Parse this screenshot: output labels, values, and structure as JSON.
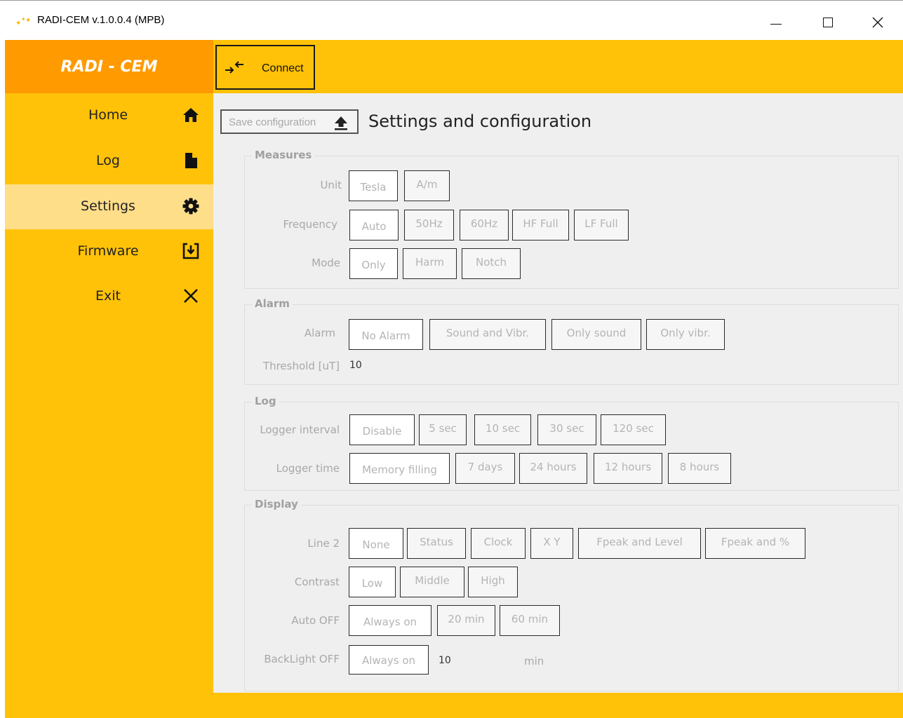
{
  "window": {
    "title": "RADI-CEM v.1.0.0.4 (MPB)",
    "icon": "sparkle-icon",
    "controls": [
      "minimize",
      "maximize",
      "close"
    ]
  },
  "sidebar": {
    "brand": "RADI - CEM",
    "items": [
      {
        "label": "Home",
        "icon": "home-icon",
        "active": false
      },
      {
        "label": "Log",
        "icon": "document-icon",
        "active": false
      },
      {
        "label": "Settings",
        "icon": "gear-icon",
        "active": true
      },
      {
        "label": "Firmware",
        "icon": "download-icon",
        "active": false
      },
      {
        "label": "Exit",
        "icon": "close-icon",
        "active": false
      }
    ]
  },
  "toolbar": {
    "connect_label": "Connect",
    "connect_icon": "connect-arrows-icon"
  },
  "main": {
    "save_label": "Save configuration",
    "save_icon": "upload-arrow-icon",
    "title": "Settings and configuration"
  },
  "measures": {
    "title": "Measures",
    "unit_label": "Unit",
    "unit_options": [
      "Tesla",
      "A/m"
    ],
    "frequency_label": "Frequency",
    "frequency_options": [
      "Auto",
      "50Hz",
      "60Hz",
      "HF Full",
      "LF Full"
    ],
    "mode_label": "Mode",
    "mode_options": [
      "Only",
      "Harm",
      "Notch"
    ]
  },
  "alarm": {
    "title": "Alarm",
    "alarm_label": "Alarm",
    "alarm_options": [
      "No Alarm",
      "Sound and Vibr.",
      "Only sound",
      "Only vibr."
    ],
    "threshold_label": "Threshold [uT]",
    "threshold_value": "10"
  },
  "log": {
    "title": "Log",
    "interval_label": "Logger interval",
    "interval_options": [
      "Disable",
      "5 sec",
      "10 sec",
      "30 sec",
      "120 sec"
    ],
    "time_label": "Logger time",
    "time_options": [
      "Memory filling",
      "7 days",
      "24 hours",
      "12 hours",
      "8 hours"
    ]
  },
  "display": {
    "title": "Display",
    "line2_label": "Line 2",
    "line2_options": [
      "None",
      "Status",
      "Clock",
      "X Y",
      "Fpeak and Level",
      "Fpeak and %"
    ],
    "contrast_label": "Contrast",
    "contrast_options": [
      "Low",
      "Middle",
      "High"
    ],
    "autooff_label": "Auto OFF",
    "autooff_options": [
      "Always on",
      "20 min",
      "60 min"
    ],
    "backlight_label": "BackLight OFF",
    "backlight_option": "Always on",
    "backlight_value": "10",
    "backlight_unit": "min"
  },
  "colors": {
    "accent": "#ffc208",
    "brand": "#ff9a00",
    "active_nav": "#ffde8a",
    "content_bg": "#efefef"
  }
}
